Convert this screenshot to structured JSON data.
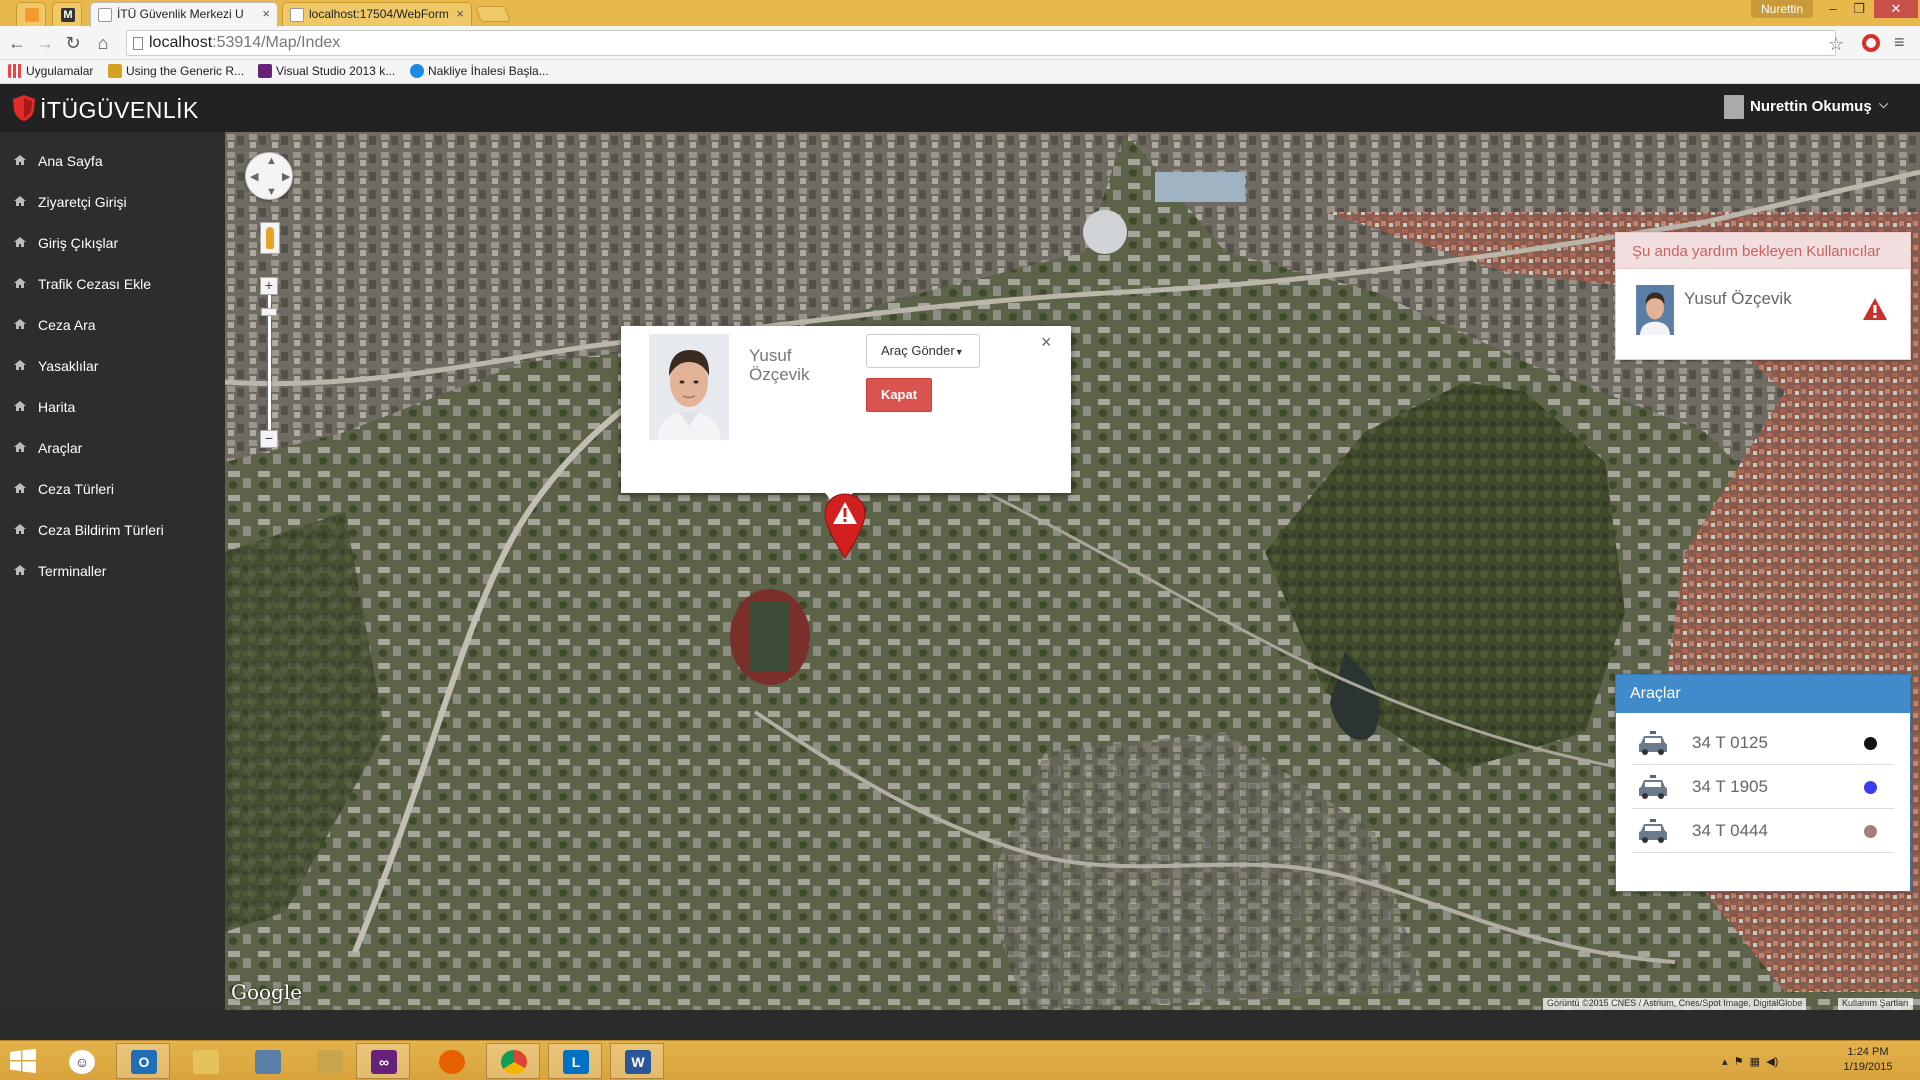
{
  "browser": {
    "tabs": [
      {
        "title": "İTÜ Güvenlik Merkezi U",
        "active": true
      },
      {
        "title": "localhost:17504/WebForm",
        "active": false
      }
    ],
    "pinned_tab_letters": [
      "",
      "M"
    ],
    "window_user": "Nurettin",
    "url_host": "localhost",
    "url_path": ":53914/Map/Index",
    "bookmarks": [
      "Uygulamalar",
      "Using the Generic R...",
      "Visual Studio 2013 k...",
      "Nakliye İhalesi Başla..."
    ]
  },
  "app": {
    "logo_text": "İTÜGÜVENLİK",
    "user_name": "Nurettin Okumuş",
    "brand_color": "#e02b2b"
  },
  "sidebar": {
    "items": [
      {
        "label": "Ana Sayfa"
      },
      {
        "label": "Ziyaretçi Girişi"
      },
      {
        "label": "Giriş Çıkışlar"
      },
      {
        "label": "Trafik Cezası Ekle"
      },
      {
        "label": "Ceza Ara"
      },
      {
        "label": "Yasaklılar"
      },
      {
        "label": "Harita"
      },
      {
        "label": "Araçlar"
      },
      {
        "label": "Ceza Türleri"
      },
      {
        "label": "Ceza Bildirim Türleri"
      },
      {
        "label": "Terminaller"
      }
    ]
  },
  "map": {
    "google_label": "Google",
    "attribution": "Görüntü ©2015 CNES / Astrium, Cnes/Spot Image, DigitalGlobe",
    "terms": "Kullanım Şartları",
    "zoom_plus": "+",
    "zoom_minus": "−"
  },
  "info_window": {
    "name": "Yusuf Özçevik",
    "send_vehicle_label": "Araç Gönder",
    "close_label": "Kapat",
    "close_x": "×"
  },
  "waiting_panel": {
    "title": "Şu anda yardım bekleyen Kullanıcılar",
    "users": [
      {
        "name": "Yusuf Özçevik"
      }
    ]
  },
  "vehicles_panel": {
    "title": "Araçlar",
    "vehicles": [
      {
        "plate": "34 T 0125",
        "color": "#111111"
      },
      {
        "plate": "34 T 1905",
        "color": "#3b3bf0"
      },
      {
        "plate": "34 T 0444",
        "color": "#a08078"
      }
    ]
  },
  "taskbar": {
    "time": "1:24 PM",
    "date": "1/19/2015"
  }
}
